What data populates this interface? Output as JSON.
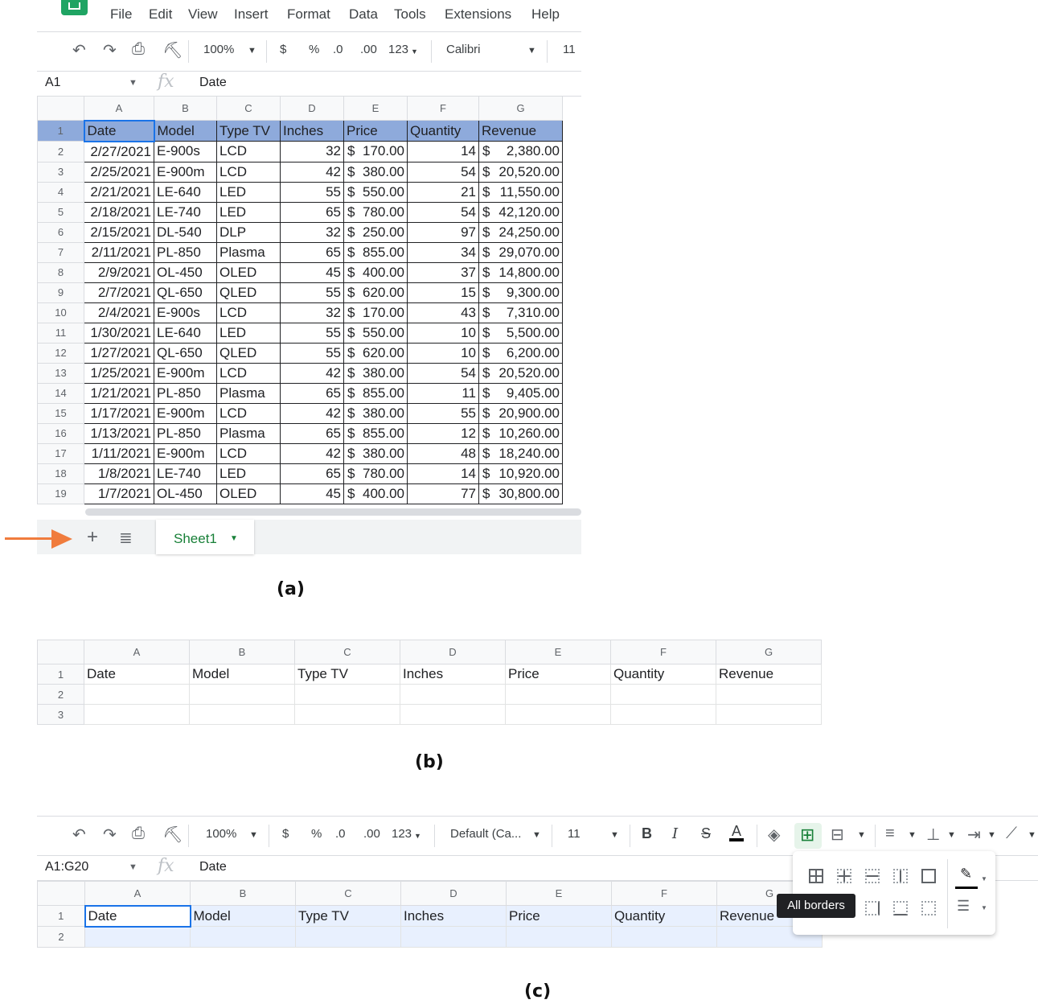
{
  "menu": [
    "File",
    "Edit",
    "View",
    "Insert",
    "Format",
    "Data",
    "Tools",
    "Extensions",
    "Help"
  ],
  "toolbar_a": {
    "zoom": "100%",
    "currency": "$",
    "percent": "%",
    "dec_less": ".0",
    "dec_more": ".00",
    "more_formats": "123",
    "font": "Calibri",
    "font_size": "11"
  },
  "formula_a": {
    "cell_ref": "A1",
    "fx": "fx",
    "content": "Date"
  },
  "columns": [
    "A",
    "B",
    "C",
    "D",
    "E",
    "F",
    "G"
  ],
  "headers": [
    "Date",
    "Model",
    "Type TV",
    "Inches",
    "Price",
    "Quantity",
    "Revenue"
  ],
  "rows": [
    [
      "2/27/2021",
      "E-900s",
      "LCD",
      "32",
      "$",
      "170.00",
      "14",
      "$",
      "2,380.00"
    ],
    [
      "2/25/2021",
      "E-900m",
      "LCD",
      "42",
      "$",
      "380.00",
      "54",
      "$",
      "20,520.00"
    ],
    [
      "2/21/2021",
      "LE-640",
      "LED",
      "55",
      "$",
      "550.00",
      "21",
      "$",
      "11,550.00"
    ],
    [
      "2/18/2021",
      "LE-740",
      "LED",
      "65",
      "$",
      "780.00",
      "54",
      "$",
      "42,120.00"
    ],
    [
      "2/15/2021",
      "DL-540",
      "DLP",
      "32",
      "$",
      "250.00",
      "97",
      "$",
      "24,250.00"
    ],
    [
      "2/11/2021",
      "PL-850",
      "Plasma",
      "65",
      "$",
      "855.00",
      "34",
      "$",
      "29,070.00"
    ],
    [
      "2/9/2021",
      "OL-450",
      "OLED",
      "45",
      "$",
      "400.00",
      "37",
      "$",
      "14,800.00"
    ],
    [
      "2/7/2021",
      "QL-650",
      "QLED",
      "55",
      "$",
      "620.00",
      "15",
      "$",
      "9,300.00"
    ],
    [
      "2/4/2021",
      "E-900s",
      "LCD",
      "32",
      "$",
      "170.00",
      "43",
      "$",
      "7,310.00"
    ],
    [
      "1/30/2021",
      "LE-640",
      "LED",
      "55",
      "$",
      "550.00",
      "10",
      "$",
      "5,500.00"
    ],
    [
      "1/27/2021",
      "QL-650",
      "QLED",
      "55",
      "$",
      "620.00",
      "10",
      "$",
      "6,200.00"
    ],
    [
      "1/25/2021",
      "E-900m",
      "LCD",
      "42",
      "$",
      "380.00",
      "54",
      "$",
      "20,520.00"
    ],
    [
      "1/21/2021",
      "PL-850",
      "Plasma",
      "65",
      "$",
      "855.00",
      "11",
      "$",
      "9,405.00"
    ],
    [
      "1/17/2021",
      "E-900m",
      "LCD",
      "42",
      "$",
      "380.00",
      "55",
      "$",
      "20,900.00"
    ],
    [
      "1/13/2021",
      "PL-850",
      "Plasma",
      "65",
      "$",
      "855.00",
      "12",
      "$",
      "10,260.00"
    ],
    [
      "1/11/2021",
      "E-900m",
      "LCD",
      "42",
      "$",
      "380.00",
      "48",
      "$",
      "18,240.00"
    ],
    [
      "1/8/2021",
      "LE-740",
      "LED",
      "65",
      "$",
      "780.00",
      "14",
      "$",
      "10,920.00"
    ],
    [
      "1/7/2021",
      "OL-450",
      "OLED",
      "45",
      "$",
      "400.00",
      "77",
      "$",
      "30,800.00"
    ]
  ],
  "sheet_tab": "Sheet1",
  "captions": {
    "a": "(a)",
    "b": "(b)",
    "c": "(c)"
  },
  "toolbar_c": {
    "zoom": "100%",
    "currency": "$",
    "percent": "%",
    "dec_less": ".0",
    "dec_more": ".00",
    "more_formats": "123",
    "font": "Default (Ca...",
    "font_size": "11",
    "bold": "B",
    "italic": "I",
    "strike": "S",
    "text_color": "A"
  },
  "formula_c": {
    "cell_ref": "A1:G20",
    "fx": "fx",
    "content": "Date"
  },
  "tooltip": "All borders",
  "colors": {
    "header_fill": "#8eaadb",
    "selection": "#e8f0fe",
    "accent": "#1a73e8",
    "sheet_green": "#188038",
    "arrow": "#f07c3d"
  }
}
